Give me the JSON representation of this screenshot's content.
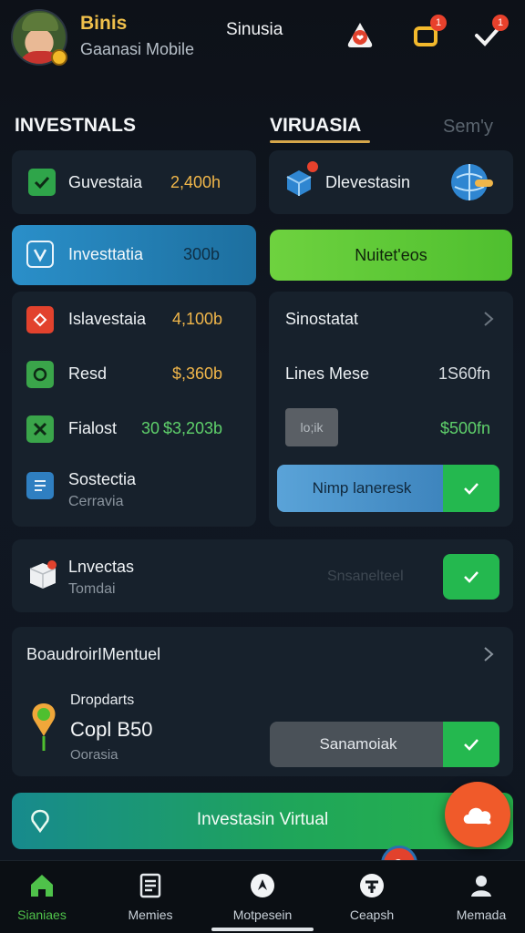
{
  "header": {
    "app_name": "Binis",
    "app_subtitle": "Gaanasi Mobile",
    "center_title": "Sinusia",
    "notif_badge_1": "1",
    "notif_badge_2": "1"
  },
  "tabs": {
    "left": "INVESTNALS",
    "middle": "VIRUASIA",
    "right": "Sem'y"
  },
  "left_cards": {
    "row1": {
      "label": "Guvestaia",
      "value": "2,400h"
    },
    "row2": {
      "label": "Investtatia",
      "value": "300b"
    },
    "list": [
      {
        "label": "Islavestaia",
        "value": "4,100b"
      },
      {
        "label": "Resd",
        "value": "$,360b"
      },
      {
        "label": "Fialost",
        "tag": "30",
        "value": "$3,203b"
      },
      {
        "label": "Sostectia",
        "sub": "Cerravia"
      }
    ]
  },
  "right_cards": {
    "top": {
      "label": "Dlevestasin"
    },
    "button": "Nuitet'eos",
    "panel": {
      "title": "Sinostatat",
      "row_label": "Lines Mese",
      "row_value": "1S60fn",
      "chip": "lo;ik",
      "amount": "$500fn",
      "action": "Nimp laneresk"
    }
  },
  "invest_row": {
    "title": "Lnvectas",
    "sub": "Tomdai",
    "faded": "Snsanelteel"
  },
  "board": {
    "title": "BoaudroirIMentuel",
    "item_title": "Dropdarts",
    "item_value": "Copl B50",
    "item_sub": "Oorasia",
    "action": "Sanamoiak"
  },
  "cta": {
    "label": "Investasin Virtual"
  },
  "nav": [
    {
      "label": "Sianiaes"
    },
    {
      "label": "Memies"
    },
    {
      "label": "Motpesein"
    },
    {
      "label": "Ceapsh"
    },
    {
      "label": "Memada"
    }
  ],
  "colors": {
    "accent_green": "#22b54c",
    "accent_blue": "#2a8fc9",
    "amber": "#f0b64a",
    "money_green": "#5fd16b",
    "fab": "#f05a2a"
  }
}
